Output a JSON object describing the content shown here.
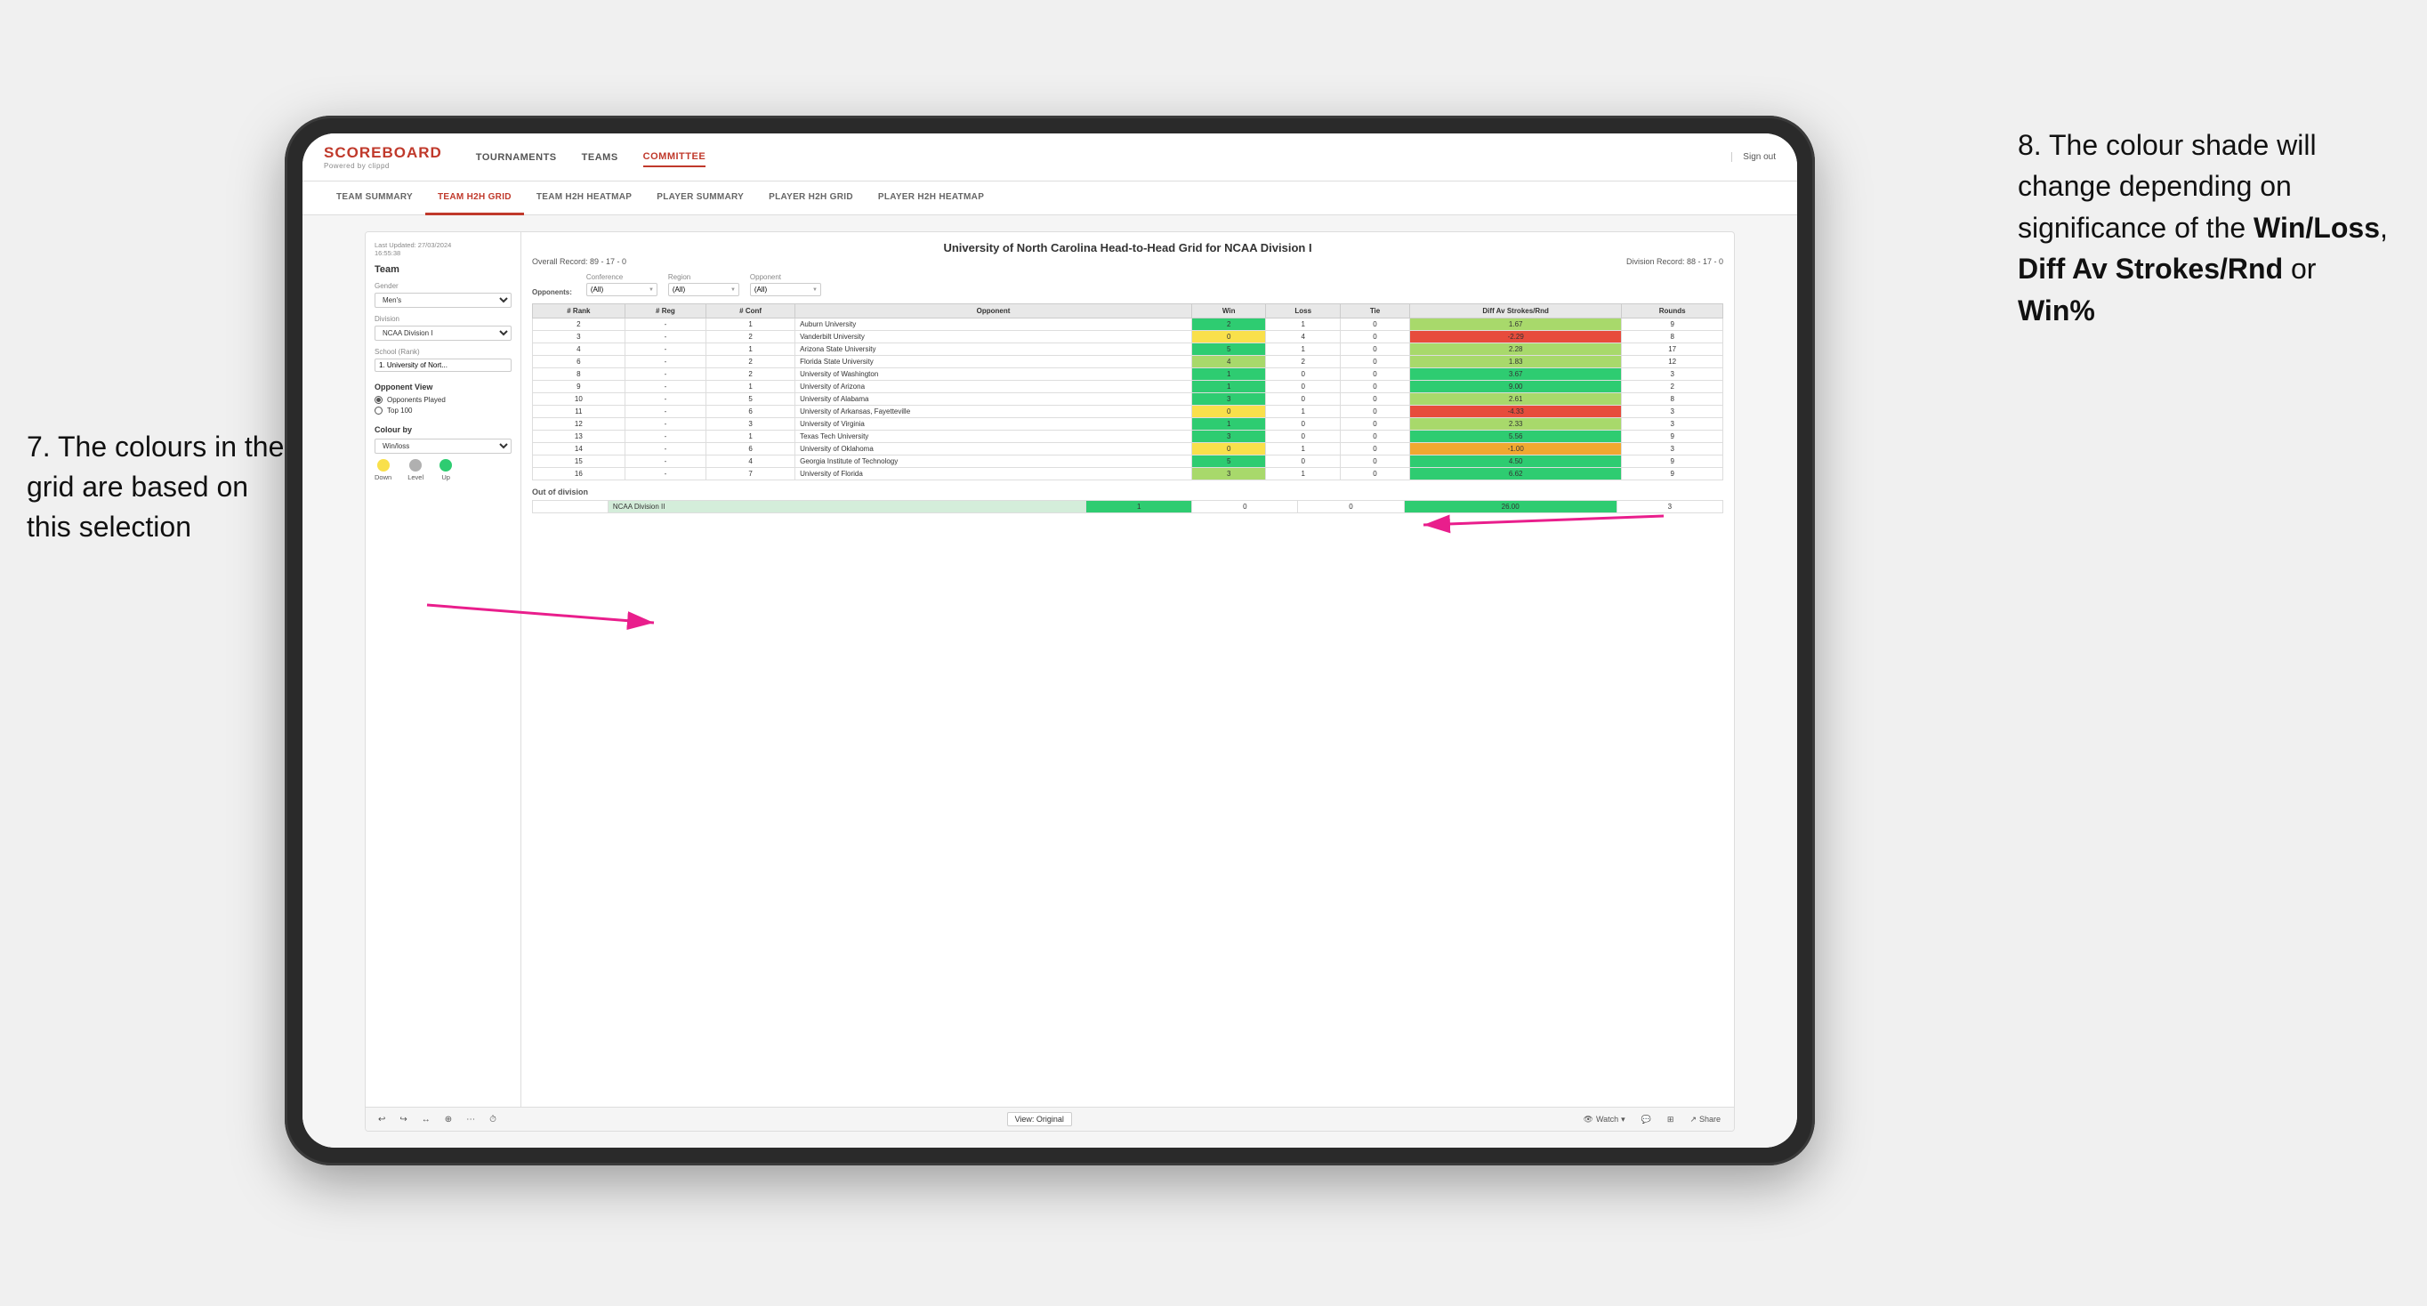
{
  "annotation_left": {
    "text": "7. The colours in the grid are based on this selection"
  },
  "annotation_right": {
    "line1": "8. The colour shade will change depending on significance of the ",
    "bold1": "Win/Loss",
    "sep1": ", ",
    "bold2": "Diff Av Strokes/Rnd",
    "sep2": " or ",
    "bold3": "Win%"
  },
  "app": {
    "logo": "SCOREBOARD",
    "logo_sub": "Powered by clippd",
    "nav": [
      "TOURNAMENTS",
      "TEAMS",
      "COMMITTEE"
    ],
    "sign_out": "Sign out",
    "sub_nav": [
      "TEAM SUMMARY",
      "TEAM H2H GRID",
      "TEAM H2H HEATMAP",
      "PLAYER SUMMARY",
      "PLAYER H2H GRID",
      "PLAYER H2H HEATMAP"
    ],
    "active_nav": "COMMITTEE",
    "active_sub": "TEAM H2H GRID"
  },
  "left_panel": {
    "timestamp_label": "Last Updated: 27/03/2024",
    "timestamp_time": "16:55:38",
    "team_section": "Team",
    "gender_label": "Gender",
    "gender_value": "Men's",
    "division_label": "Division",
    "division_value": "NCAA Division I",
    "school_label": "School (Rank)",
    "school_value": "1. University of Nort...",
    "opponent_view_title": "Opponent View",
    "radio_options": [
      "Opponents Played",
      "Top 100"
    ],
    "radio_selected": "Opponents Played",
    "colour_by_title": "Colour by",
    "colour_by_value": "Win/loss",
    "legend": [
      {
        "label": "Down",
        "color": "#f9e04b"
      },
      {
        "label": "Level",
        "color": "#b0b0b0"
      },
      {
        "label": "Up",
        "color": "#2ecc71"
      }
    ]
  },
  "grid": {
    "title": "University of North Carolina Head-to-Head Grid for NCAA Division I",
    "overall_record": "Overall Record: 89 - 17 - 0",
    "division_record": "Division Record: 88 - 17 - 0",
    "filter_opponents_label": "Opponents:",
    "filters": [
      {
        "label": "Conference",
        "value": "(All)"
      },
      {
        "label": "Region",
        "value": "(All)"
      },
      {
        "label": "Opponent",
        "value": "(All)"
      }
    ],
    "col_headers": [
      "#\nRank",
      "#\nReg",
      "#\nConf",
      "Opponent",
      "Win",
      "Loss",
      "Tie",
      "Diff Av\nStrokes/Rnd",
      "Rounds"
    ],
    "rows": [
      {
        "rank": "2",
        "reg": "-",
        "conf": "1",
        "opponent": "Auburn University",
        "win": "2",
        "loss": "1",
        "tie": "0",
        "diff": "1.67",
        "rounds": "9",
        "win_color": "cell-green-dark",
        "loss_color": "cell-white",
        "diff_color": "cell-green-mid"
      },
      {
        "rank": "3",
        "reg": "-",
        "conf": "2",
        "opponent": "Vanderbilt University",
        "win": "0",
        "loss": "4",
        "tie": "0",
        "diff": "-2.29",
        "rounds": "8",
        "win_color": "cell-yellow",
        "loss_color": "cell-white",
        "diff_color": "cell-red"
      },
      {
        "rank": "4",
        "reg": "-",
        "conf": "1",
        "opponent": "Arizona State University",
        "win": "5",
        "loss": "1",
        "tie": "0",
        "diff": "2.28",
        "rounds": "17",
        "win_color": "cell-green-dark",
        "loss_color": "cell-white",
        "diff_color": "cell-green-mid"
      },
      {
        "rank": "6",
        "reg": "-",
        "conf": "2",
        "opponent": "Florida State University",
        "win": "4",
        "loss": "2",
        "tie": "0",
        "diff": "1.83",
        "rounds": "12",
        "win_color": "cell-green-mid",
        "loss_color": "cell-white",
        "diff_color": "cell-green-mid"
      },
      {
        "rank": "8",
        "reg": "-",
        "conf": "2",
        "opponent": "University of Washington",
        "win": "1",
        "loss": "0",
        "tie": "0",
        "diff": "3.67",
        "rounds": "3",
        "win_color": "cell-green-dark",
        "loss_color": "cell-white",
        "diff_color": "cell-green-dark"
      },
      {
        "rank": "9",
        "reg": "-",
        "conf": "1",
        "opponent": "University of Arizona",
        "win": "1",
        "loss": "0",
        "tie": "0",
        "diff": "9.00",
        "rounds": "2",
        "win_color": "cell-green-dark",
        "loss_color": "cell-white",
        "diff_color": "cell-green-dark"
      },
      {
        "rank": "10",
        "reg": "-",
        "conf": "5",
        "opponent": "University of Alabama",
        "win": "3",
        "loss": "0",
        "tie": "0",
        "diff": "2.61",
        "rounds": "8",
        "win_color": "cell-green-dark",
        "loss_color": "cell-white",
        "diff_color": "cell-green-mid"
      },
      {
        "rank": "11",
        "reg": "-",
        "conf": "6",
        "opponent": "University of Arkansas, Fayetteville",
        "win": "0",
        "loss": "1",
        "tie": "0",
        "diff": "-4.33",
        "rounds": "3",
        "win_color": "cell-yellow",
        "loss_color": "cell-white",
        "diff_color": "cell-red"
      },
      {
        "rank": "12",
        "reg": "-",
        "conf": "3",
        "opponent": "University of Virginia",
        "win": "1",
        "loss": "0",
        "tie": "0",
        "diff": "2.33",
        "rounds": "3",
        "win_color": "cell-green-dark",
        "loss_color": "cell-white",
        "diff_color": "cell-green-mid"
      },
      {
        "rank": "13",
        "reg": "-",
        "conf": "1",
        "opponent": "Texas Tech University",
        "win": "3",
        "loss": "0",
        "tie": "0",
        "diff": "5.56",
        "rounds": "9",
        "win_color": "cell-green-dark",
        "loss_color": "cell-white",
        "diff_color": "cell-green-dark"
      },
      {
        "rank": "14",
        "reg": "-",
        "conf": "6",
        "opponent": "University of Oklahoma",
        "win": "0",
        "loss": "1",
        "tie": "0",
        "diff": "-1.00",
        "rounds": "3",
        "win_color": "cell-yellow",
        "loss_color": "cell-white",
        "diff_color": "cell-orange"
      },
      {
        "rank": "15",
        "reg": "-",
        "conf": "4",
        "opponent": "Georgia Institute of Technology",
        "win": "5",
        "loss": "0",
        "tie": "0",
        "diff": "4.50",
        "rounds": "9",
        "win_color": "cell-green-dark",
        "loss_color": "cell-white",
        "diff_color": "cell-green-dark"
      },
      {
        "rank": "16",
        "reg": "-",
        "conf": "7",
        "opponent": "University of Florida",
        "win": "3",
        "loss": "1",
        "tie": "0",
        "diff": "6.62",
        "rounds": "9",
        "win_color": "cell-green-mid",
        "loss_color": "cell-white",
        "diff_color": "cell-green-dark"
      }
    ],
    "out_of_division_label": "Out of division",
    "out_of_division_row": {
      "division": "NCAA Division II",
      "win": "1",
      "loss": "0",
      "tie": "0",
      "diff": "26.00",
      "rounds": "3",
      "win_color": "cell-green-dark",
      "diff_color": "cell-green-dark"
    }
  },
  "toolbar_bottom": {
    "view_original": "View: Original",
    "watch": "Watch",
    "share": "Share"
  }
}
